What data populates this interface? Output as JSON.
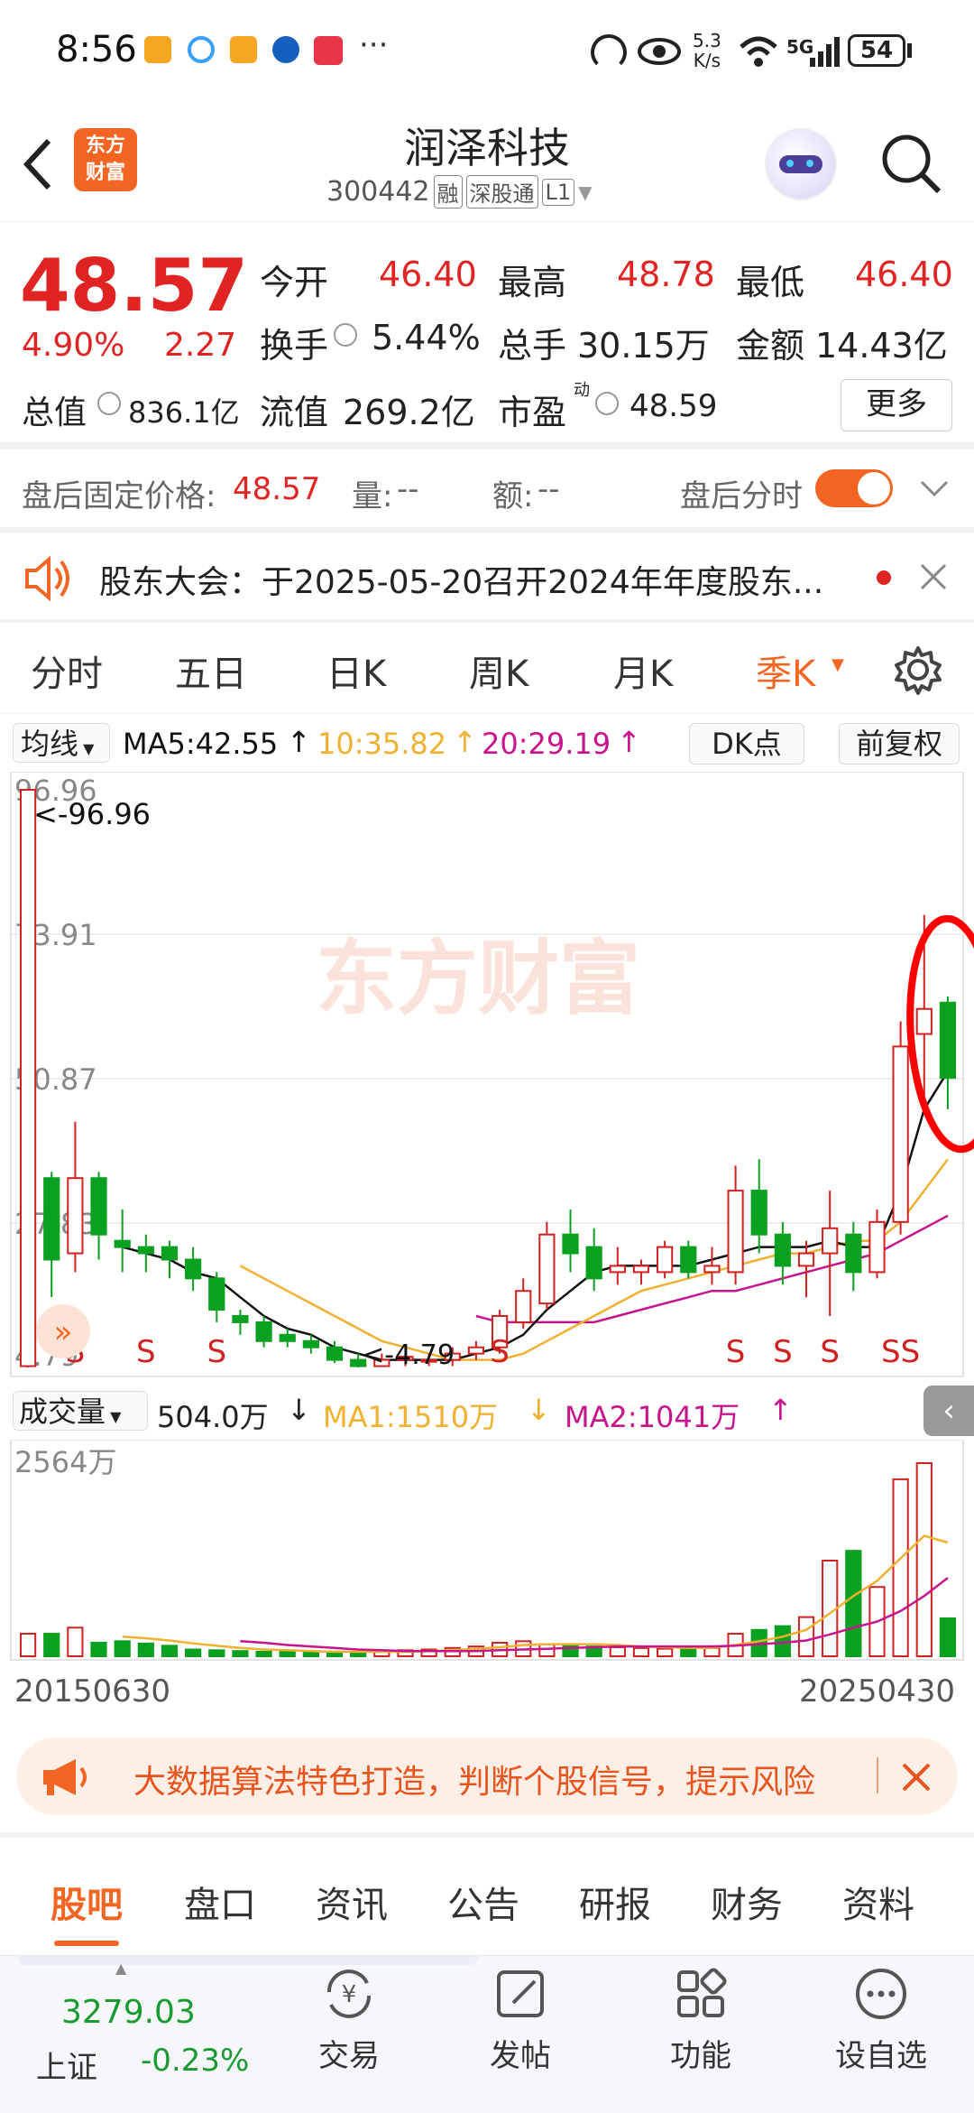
{
  "status": {
    "time": "8:56",
    "net_speed_top": "5.3",
    "net_speed_bottom": "K/s",
    "network": "5G",
    "battery": "54"
  },
  "header": {
    "app_logo_top": "东方",
    "app_logo_bottom": "财富",
    "title": "润泽科技",
    "code": "300442",
    "tags": [
      "融",
      "深股通",
      "L1"
    ]
  },
  "quote": {
    "price": "48.57",
    "change_pct": "4.90%",
    "change": "2.27",
    "open_label": "今开",
    "open": "46.40",
    "high_label": "最高",
    "high": "48.78",
    "low_label": "最低",
    "low": "46.40",
    "turnover_label": "换手",
    "turnover": "5.44%",
    "volume_label": "总手",
    "volume": "30.15万",
    "amount_label": "金额",
    "amount": "14.43亿",
    "mktcap_label": "总值",
    "mktcap": "836.1亿",
    "float_label": "流值",
    "float_cap": "269.2亿",
    "pe_label": "市盈",
    "pe_sup": "动",
    "pe": "48.59",
    "more_label": "更多"
  },
  "afterhours": {
    "price_label": "盘后固定价格:",
    "price": "48.57",
    "vol_label": "量:",
    "vol": "--",
    "amt_label": "额:",
    "amt": "--",
    "toggle_label": "盘后分时",
    "toggle_on": true
  },
  "notice": {
    "text": "股东大会：于2025-05-20召开2024年年度股东..."
  },
  "chart_tabs": [
    "分时",
    "五日",
    "日K",
    "周K",
    "月K",
    "季K"
  ],
  "active_chart_tab": "季K",
  "ma_bar": {
    "label": "均线",
    "ma5": "MA5:42.55",
    "ma10": "10:35.82",
    "ma20": "20:29.19",
    "dk_label": "DK点",
    "adjust_label": "前复权",
    "colors": {
      "ma5": "#111111",
      "ma10": "#f0b030",
      "ma20": "#c8148c"
    }
  },
  "chart_data": {
    "type": "candlestick",
    "y_ticks": [
      "96.96",
      "73.91",
      "50.87",
      "27.83",
      "4.79"
    ],
    "ylim": [
      4.79,
      96.96
    ],
    "max_marker": "<-96.96",
    "min_marker": "<-4.79",
    "watermark": "东方财富",
    "candles": [
      {
        "o": 5,
        "c": 96.96,
        "h": 96.96,
        "l": 4.79
      },
      {
        "o": 35,
        "c": 22,
        "h": 36,
        "l": 16
      },
      {
        "o": 23,
        "c": 35,
        "h": 44,
        "l": 20
      },
      {
        "o": 35,
        "c": 26,
        "h": 36,
        "l": 22
      },
      {
        "o": 25,
        "c": 24,
        "h": 30,
        "l": 20
      },
      {
        "o": 24,
        "c": 23,
        "h": 26,
        "l": 20
      },
      {
        "o": 24,
        "c": 22,
        "h": 25,
        "l": 19
      },
      {
        "o": 22,
        "c": 19,
        "h": 24,
        "l": 17
      },
      {
        "o": 19,
        "c": 14,
        "h": 20,
        "l": 12
      },
      {
        "o": 13,
        "c": 12,
        "h": 14,
        "l": 10
      },
      {
        "o": 12,
        "c": 9,
        "h": 13,
        "l": 8
      },
      {
        "o": 10,
        "c": 9,
        "h": 11,
        "l": 8
      },
      {
        "o": 9,
        "c": 8,
        "h": 10,
        "l": 7
      },
      {
        "o": 8,
        "c": 6,
        "h": 9,
        "l": 5.5
      },
      {
        "o": 6,
        "c": 5,
        "h": 7,
        "l": 4.79
      },
      {
        "o": 5,
        "c": 6,
        "h": 7,
        "l": 5
      },
      {
        "o": 6,
        "c": 6.5,
        "h": 7,
        "l": 5
      },
      {
        "o": 6,
        "c": 6,
        "h": 7,
        "l": 5
      },
      {
        "o": 6,
        "c": 7,
        "h": 8,
        "l": 5
      },
      {
        "o": 7,
        "c": 8,
        "h": 9,
        "l": 6
      },
      {
        "o": 8,
        "c": 13,
        "h": 14,
        "l": 7
      },
      {
        "o": 12,
        "c": 17,
        "h": 19,
        "l": 11
      },
      {
        "o": 15,
        "c": 26,
        "h": 28,
        "l": 14
      },
      {
        "o": 26,
        "c": 23,
        "h": 30,
        "l": 20
      },
      {
        "o": 24,
        "c": 19,
        "h": 27,
        "l": 17
      },
      {
        "o": 20,
        "c": 21,
        "h": 24,
        "l": 18
      },
      {
        "o": 20,
        "c": 21,
        "h": 22,
        "l": 18
      },
      {
        "o": 20,
        "c": 24,
        "h": 25,
        "l": 19
      },
      {
        "o": 24,
        "c": 20,
        "h": 25,
        "l": 19
      },
      {
        "o": 20,
        "c": 21,
        "h": 24,
        "l": 18
      },
      {
        "o": 20,
        "c": 33,
        "h": 37,
        "l": 18
      },
      {
        "o": 33,
        "c": 26,
        "h": 38,
        "l": 23
      },
      {
        "o": 26,
        "c": 21,
        "h": 28,
        "l": 18
      },
      {
        "o": 21,
        "c": 23,
        "h": 25,
        "l": 16
      },
      {
        "o": 23,
        "c": 27,
        "h": 33,
        "l": 13
      },
      {
        "o": 26,
        "c": 20,
        "h": 28,
        "l": 17
      },
      {
        "o": 20,
        "c": 28,
        "h": 30,
        "l": 19
      },
      {
        "o": 28,
        "c": 56,
        "h": 60,
        "l": 26
      },
      {
        "o": 58,
        "c": 62,
        "h": 77,
        "l": 48
      },
      {
        "o": 63,
        "c": 51,
        "h": 64,
        "l": 46
      }
    ],
    "signals": [
      {
        "label": "S",
        "i": 2
      },
      {
        "label": "S",
        "i": 5
      },
      {
        "label": "S",
        "i": 8
      },
      {
        "label": "S",
        "i": 20
      },
      {
        "label": "S",
        "i": 30
      },
      {
        "label": "S",
        "i": 32
      },
      {
        "label": "S",
        "i": 34
      },
      {
        "label": "SS",
        "i": 37
      }
    ],
    "ma5_values": [
      null,
      null,
      null,
      null,
      24,
      23,
      22,
      20,
      19,
      16,
      13,
      11,
      10,
      8,
      7,
      6,
      6,
      6,
      6,
      7,
      8,
      10,
      14,
      17,
      20,
      21,
      21,
      21,
      21,
      22,
      23,
      24,
      24,
      24,
      25,
      24,
      24,
      33,
      46,
      52
    ],
    "ma10_values": [
      null,
      null,
      null,
      null,
      null,
      null,
      null,
      null,
      null,
      21,
      19,
      17,
      15,
      13,
      11,
      9,
      8,
      7,
      6,
      6,
      6,
      7,
      9,
      11,
      13,
      15,
      17,
      18,
      19,
      20,
      21,
      22,
      23,
      23,
      24,
      25,
      25,
      28,
      33,
      38
    ],
    "ma20_values": [
      null,
      null,
      null,
      null,
      null,
      null,
      null,
      null,
      null,
      null,
      null,
      null,
      null,
      null,
      null,
      null,
      null,
      null,
      null,
      13,
      12,
      12,
      12,
      12,
      12,
      13,
      14,
      15,
      16,
      17,
      17,
      18,
      19,
      20,
      21,
      22,
      23,
      25,
      27,
      29
    ],
    "volume": {
      "label": "成交量",
      "vol_value": "504.0万",
      "ma1": "MA1:1510万",
      "ma2": "MA2:1041万",
      "max_tick": "2564万",
      "x_start": "20150630",
      "x_end": "20250430",
      "values": [
        300,
        300,
        380,
        180,
        200,
        170,
        140,
        90,
        80,
        70,
        60,
        60,
        50,
        50,
        50,
        70,
        80,
        90,
        110,
        130,
        180,
        200,
        160,
        150,
        130,
        120,
        110,
        100,
        100,
        110,
        300,
        350,
        400,
        520,
        1270,
        1400,
        920,
        2350,
        2564,
        504
      ],
      "ma1_values": [
        null,
        null,
        null,
        null,
        260,
        240,
        210,
        170,
        140,
        110,
        90,
        80,
        70,
        60,
        60,
        60,
        60,
        70,
        80,
        100,
        120,
        150,
        160,
        160,
        160,
        150,
        130,
        120,
        110,
        110,
        150,
        200,
        260,
        350,
        570,
        800,
        1000,
        1300,
        1600,
        1510
      ],
      "ma2_values": [
        null,
        null,
        null,
        null,
        null,
        null,
        null,
        null,
        null,
        200,
        180,
        150,
        130,
        110,
        90,
        80,
        70,
        70,
        70,
        70,
        80,
        90,
        100,
        110,
        120,
        130,
        130,
        130,
        130,
        130,
        140,
        160,
        180,
        210,
        290,
        380,
        460,
        600,
        800,
        1041
      ]
    }
  },
  "ad_banner": {
    "text": "大数据算法特色打造，判断个股信号，提示风险"
  },
  "bottom_tabs": [
    "股吧",
    "盘口",
    "资讯",
    "公告",
    "研报",
    "财务",
    "资料"
  ],
  "active_bottom_tab": "股吧",
  "nav": {
    "index_value": "3279.03",
    "index_name": "上证",
    "index_change": "-0.23%",
    "items": [
      "交易",
      "发帖",
      "功能",
      "设自选"
    ]
  }
}
